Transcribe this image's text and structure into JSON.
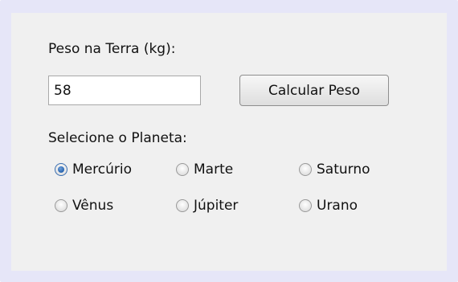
{
  "form": {
    "weight_label": "Peso na Terra (kg):",
    "weight_value": "58",
    "calculate_button": "Calcular Peso",
    "planet_label": "Selecione o Planeta:",
    "selected_planet": "Mercúrio",
    "planets": [
      {
        "label": "Mercúrio",
        "checked": true
      },
      {
        "label": "Marte",
        "checked": false
      },
      {
        "label": "Saturno",
        "checked": false
      },
      {
        "label": "Vênus",
        "checked": false
      },
      {
        "label": "Júpiter",
        "checked": false
      },
      {
        "label": "Urano",
        "checked": false
      }
    ]
  },
  "colors": {
    "frame_border": "#e6e6f8",
    "panel_background": "#f0f0f0",
    "radio_selected": "#2f6bb5"
  }
}
